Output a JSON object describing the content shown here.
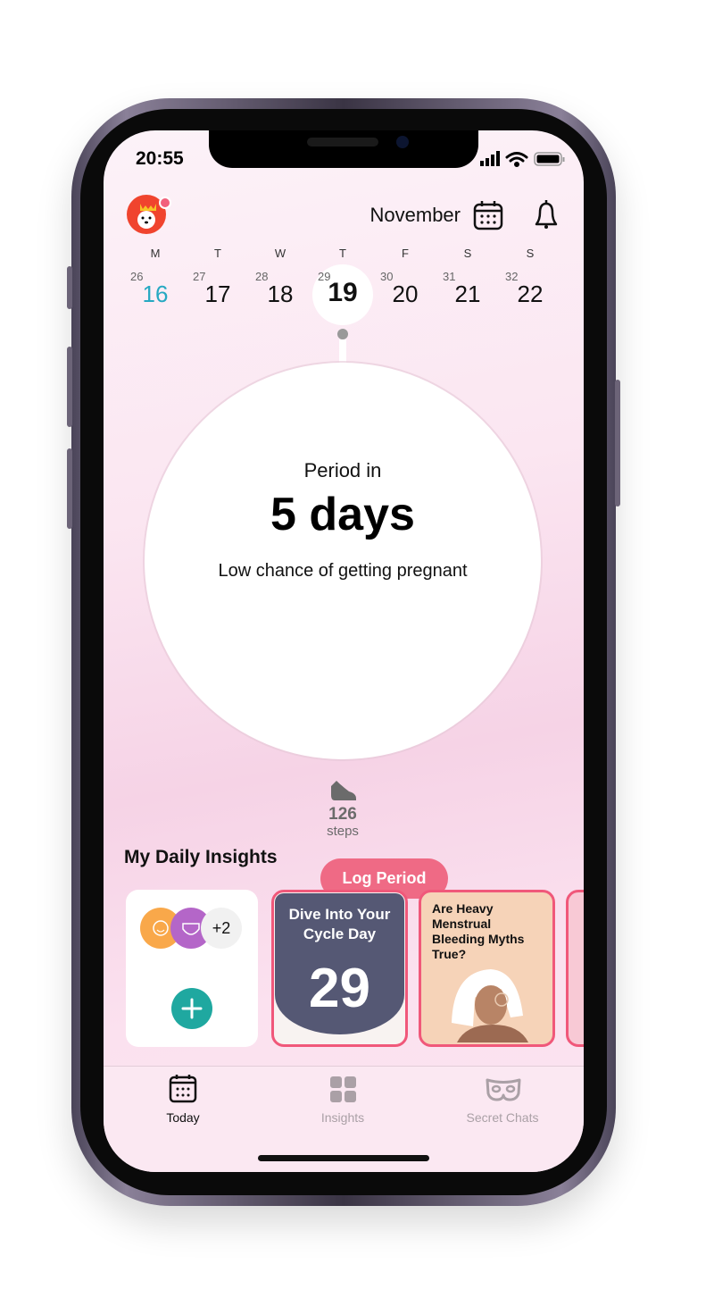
{
  "status": {
    "time": "20:55"
  },
  "header": {
    "month": "November",
    "avatar_icon": "dog-avatar-icon",
    "calendar_icon": "calendar-icon",
    "bell_icon": "bell-icon"
  },
  "week": {
    "days": [
      {
        "letter": "M",
        "cycle_day": "26",
        "date": "16"
      },
      {
        "letter": "T",
        "cycle_day": "27",
        "date": "17"
      },
      {
        "letter": "W",
        "cycle_day": "28",
        "date": "18"
      },
      {
        "letter": "T",
        "cycle_day": "29",
        "date": "19"
      },
      {
        "letter": "F",
        "cycle_day": "30",
        "date": "20"
      },
      {
        "letter": "S",
        "cycle_day": "31",
        "date": "21"
      },
      {
        "letter": "S",
        "cycle_day": "32",
        "date": "22"
      }
    ],
    "selected_index": 3,
    "today_color": "#26A9C2"
  },
  "main": {
    "period_label": "Period in",
    "period_value": "5 days",
    "chance": "Low chance of getting pregnant",
    "log_button": "Log Period"
  },
  "steps": {
    "count": "126",
    "label": "steps"
  },
  "insights": {
    "title": "My Daily Insights",
    "extra_count": "+2",
    "cards": [
      {
        "title": "Dive Into Your Cycle Day",
        "number": "29"
      },
      {
        "title": "Are Heavy Menstrual Bleeding Myths True?"
      }
    ]
  },
  "tabs": [
    {
      "label": "Today",
      "active": true
    },
    {
      "label": "Insights"
    },
    {
      "label": "Secret Chats"
    }
  ],
  "colors": {
    "accent": "#EF6A85",
    "teal": "#1FA8A0"
  }
}
